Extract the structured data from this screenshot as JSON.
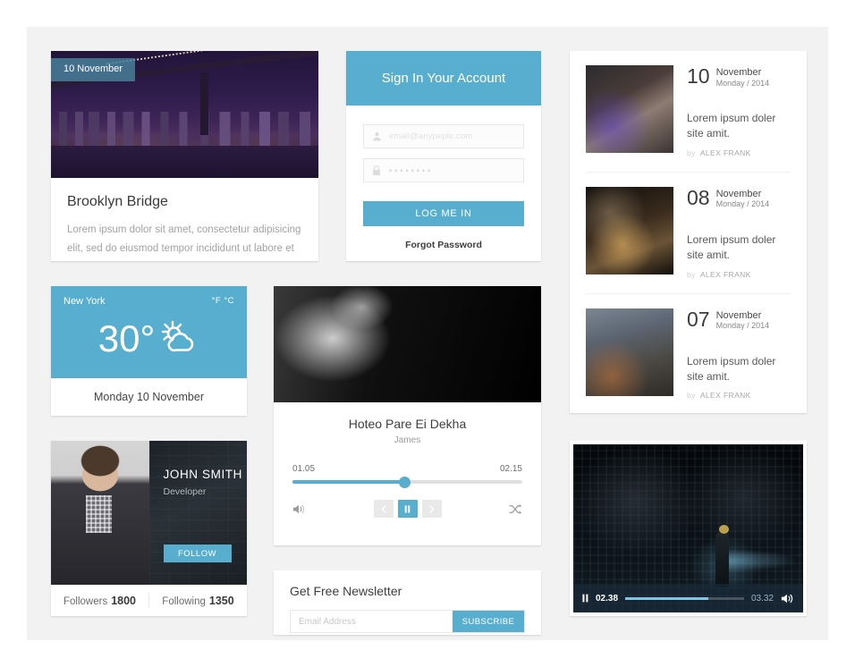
{
  "theme": {
    "accent": "#58aece",
    "page_bg": "#f2f2f2",
    "card_bg": "#ffffff"
  },
  "bridge_card": {
    "date_badge": "10 November",
    "title": "Brooklyn Bridge",
    "body": "Lorem ipsum dolor sit amet, consectetur adipisicing elit, sed do eiusmod tempor incididunt ut labore et dolore magna aliqua. Ut enim ad minim veniam."
  },
  "signin_card": {
    "heading": "Sign In Your Account",
    "email_placeholder": "email@anypeple.com",
    "email_value": "",
    "email_icon": "user-icon",
    "password_value": "••••••••",
    "password_icon": "lock-icon",
    "login_label": "LOG ME IN",
    "forgot_label": "Forgot Password"
  },
  "news_card": {
    "items": [
      {
        "day": "10",
        "month": "November",
        "weekday_year": "Monday / 2014",
        "title": "Lorem ipsum doler site amit.",
        "by_word": "by",
        "author": "ALEX FRANK",
        "thumb": "person-with-phone-photo"
      },
      {
        "day": "08",
        "month": "November",
        "weekday_year": "Monday / 2014",
        "title": "Lorem ipsum doler site amit.",
        "by_word": "by",
        "author": "ALEX FRANK",
        "thumb": "candle-carousel-photo"
      },
      {
        "day": "07",
        "month": "November",
        "weekday_year": "Monday / 2014",
        "title": "Lorem ipsum doler site amit.",
        "by_word": "by",
        "author": "ALEX FRANK",
        "thumb": "city-street-photo"
      }
    ]
  },
  "weather_card": {
    "city": "New York",
    "units": "°F °C",
    "temperature": "30°",
    "condition_icon": "sun-behind-cloud-icon",
    "date": "Monday 10 November"
  },
  "music_card": {
    "cover": "musician-bw-photo",
    "song_title": "Hoteo Pare Ei Dekha",
    "artist": "James",
    "elapsed": "01.05",
    "duration": "02.15",
    "progress_percent": 49,
    "controls": {
      "volume_icon": "volume-icon",
      "prev_icon": "previous-icon",
      "play_pause_icon": "pause-icon",
      "next_icon": "next-icon",
      "shuffle_icon": "shuffle-icon"
    }
  },
  "profile_card": {
    "photo": "man-in-suit-photo",
    "name": "JOHN SMITH",
    "role": "Developer",
    "follow_label": "FOLLOW",
    "stats": [
      {
        "label": "Followers",
        "value": "1800"
      },
      {
        "label": "Following",
        "value": "1350"
      }
    ]
  },
  "newsletter_card": {
    "title": "Get Free Newsletter",
    "email_placeholder": "Email Address",
    "email_value": "",
    "subscribe_label": "SUBSCRIBE"
  },
  "video_card": {
    "scene": "dark-scifi-corridor-photo",
    "state_icon": "pause-icon",
    "elapsed": "02.38",
    "duration": "03.32",
    "progress_percent": 70,
    "volume_icon": "volume-icon"
  }
}
